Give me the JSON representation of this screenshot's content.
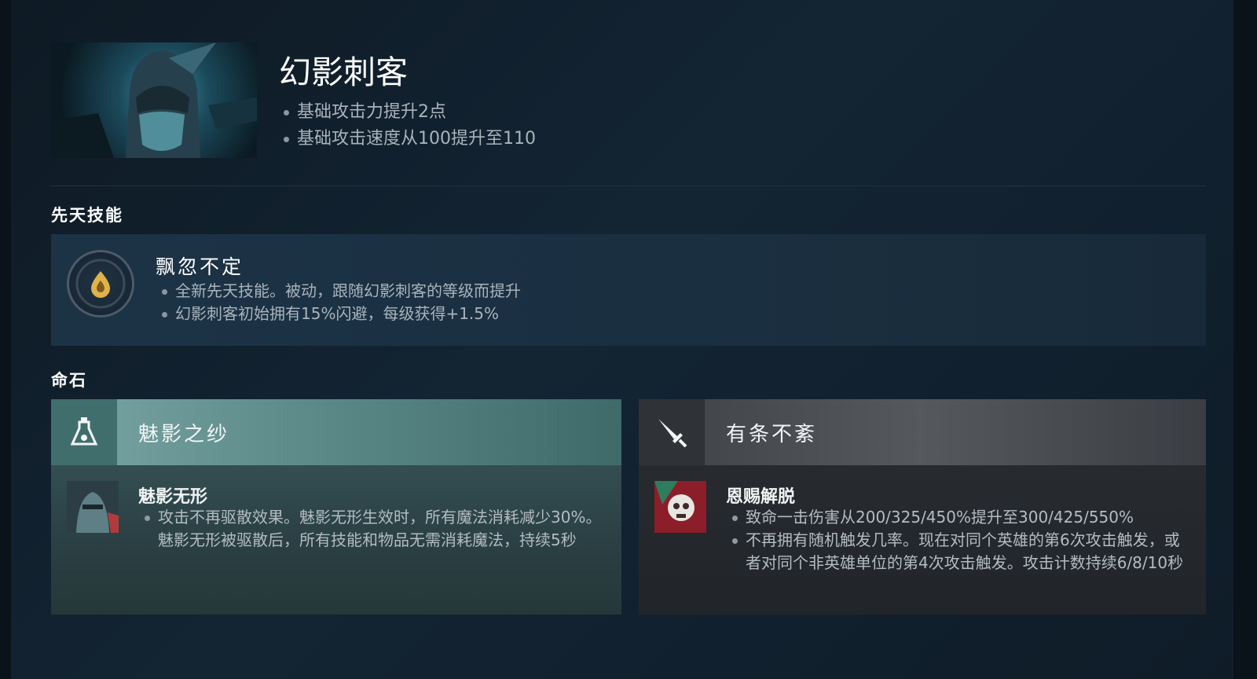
{
  "hero": {
    "name": "幻影刺客",
    "changes": [
      "基础攻击力提升2点",
      "基础攻击速度从100提升至110"
    ]
  },
  "innate": {
    "section_title": "先天技能",
    "name": "飘忽不定",
    "icon": "drop-icon",
    "details": [
      "全新先天技能。被动，跟随幻影刺客的等级而提升",
      "幻影刺客初始拥有15%闪避，每级获得+1.5%"
    ]
  },
  "facets": {
    "section_title": "命石",
    "items": [
      {
        "name": "魅影之纱",
        "icon": "potion-icon",
        "color": "#5f8d8c",
        "ability_name": "魅影无形",
        "details": [
          "攻击不再驱散效果。魅影无形生效时，所有魔法消耗减少30%。魅影无形被驱散后，所有技能和物品无需消耗魔法，持续5秒"
        ]
      },
      {
        "name": "有条不紊",
        "icon": "dagger-icon",
        "color": "#4a4e53",
        "ability_name": "恩赐解脱",
        "details": [
          "致命一击伤害从200/325/450%提升至300/425/550%",
          "不再拥有随机触发几率。现在对同个英雄的第6次攻击触发，或者对同个非英雄单位的第4次攻击触发。攻击计数持续6/8/10秒"
        ]
      }
    ]
  }
}
